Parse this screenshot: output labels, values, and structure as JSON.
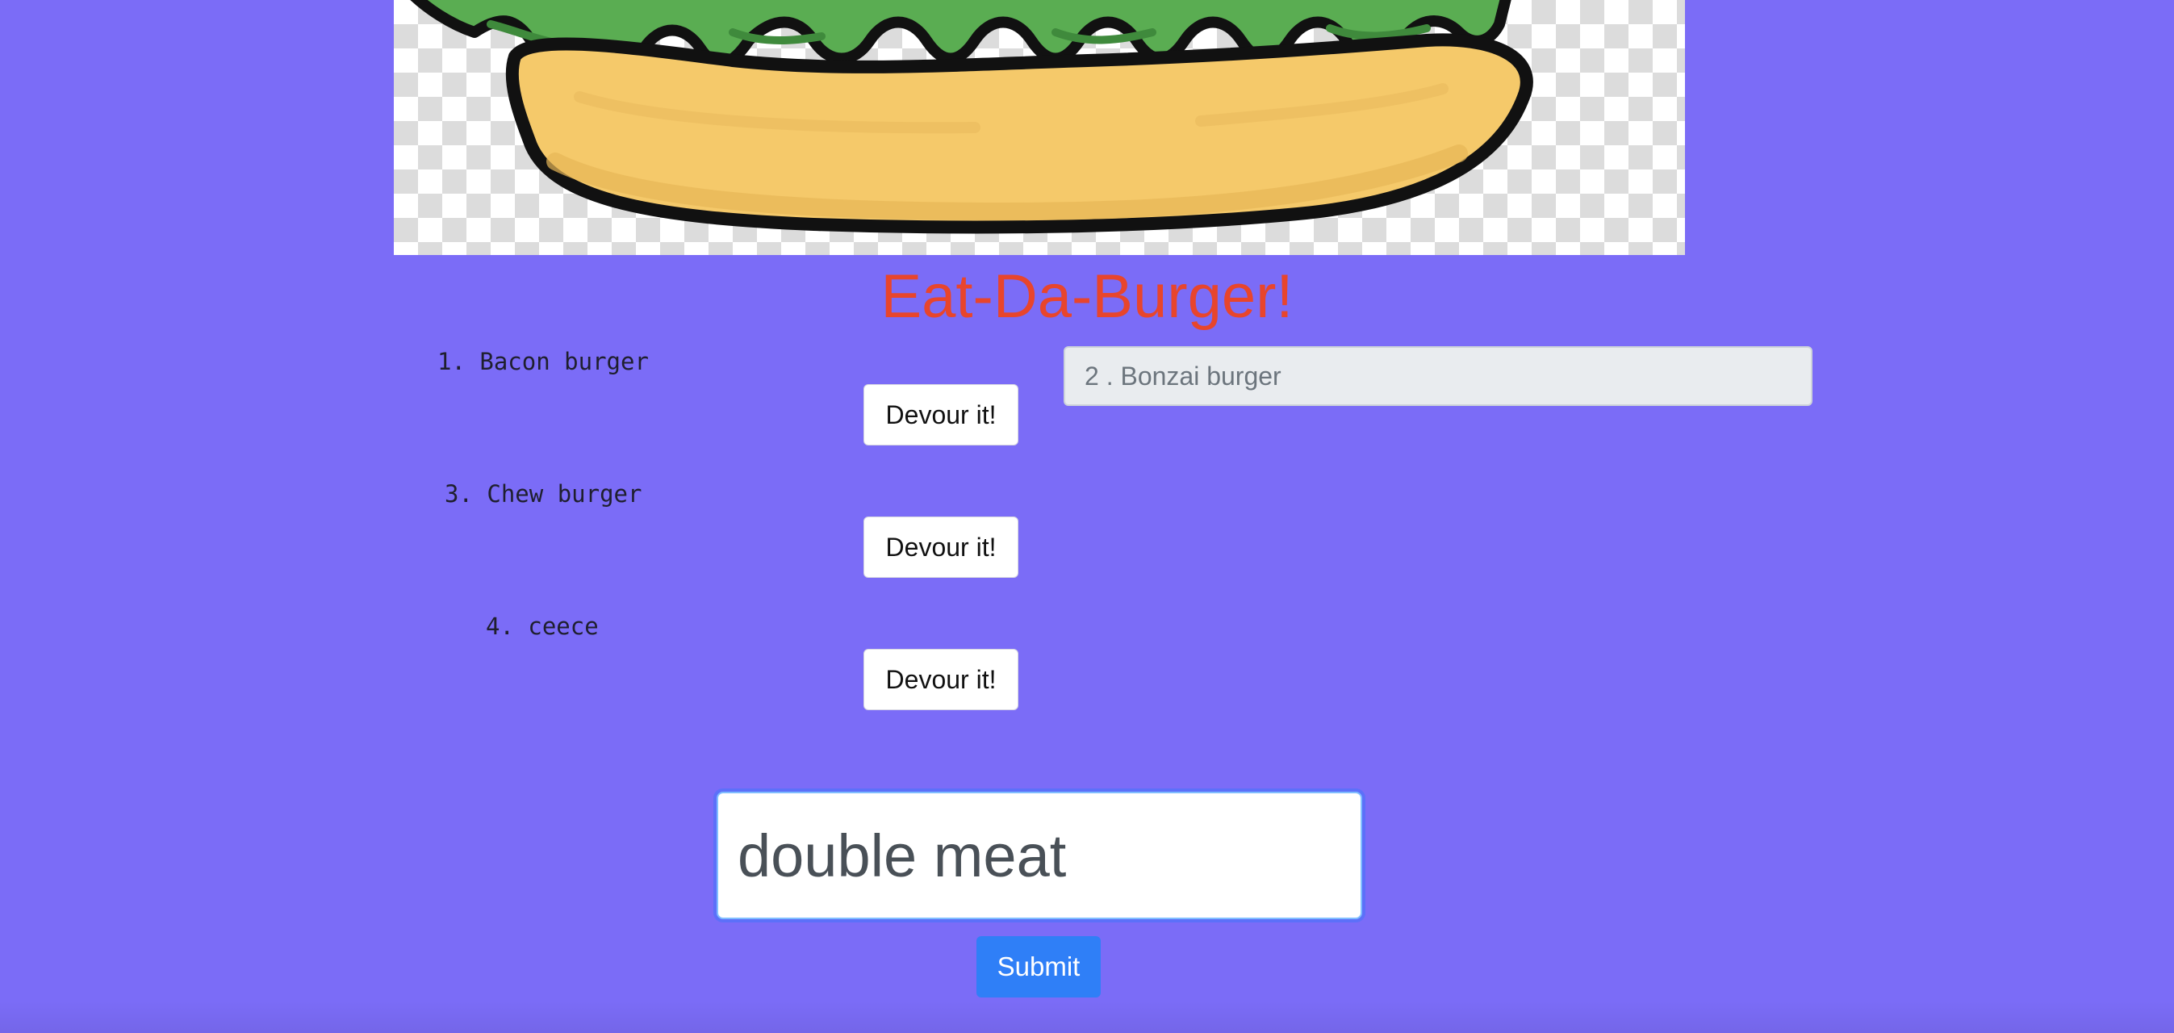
{
  "app": {
    "title": "Eat-Da-Burger!",
    "hero_image": "burger-illustration"
  },
  "burgers_available": [
    {
      "number": "1.",
      "name": "Bacon burger",
      "button_label": "Devour it!"
    },
    {
      "number": "3.",
      "name": "Chew burger",
      "button_label": "Devour it!"
    },
    {
      "number": "4.",
      "name": "ceece",
      "button_label": "Devour it!"
    }
  ],
  "burgers_devoured": [
    {
      "label": "2 . Bonzai burger"
    }
  ],
  "form": {
    "input_value": "double meat",
    "submit_label": "Submit"
  },
  "colors": {
    "background": "#7b6cf7",
    "title": "#e8452c",
    "submit_button": "#2f7ff7",
    "lettuce": "#5aad52",
    "bun": "#f5c96a"
  }
}
